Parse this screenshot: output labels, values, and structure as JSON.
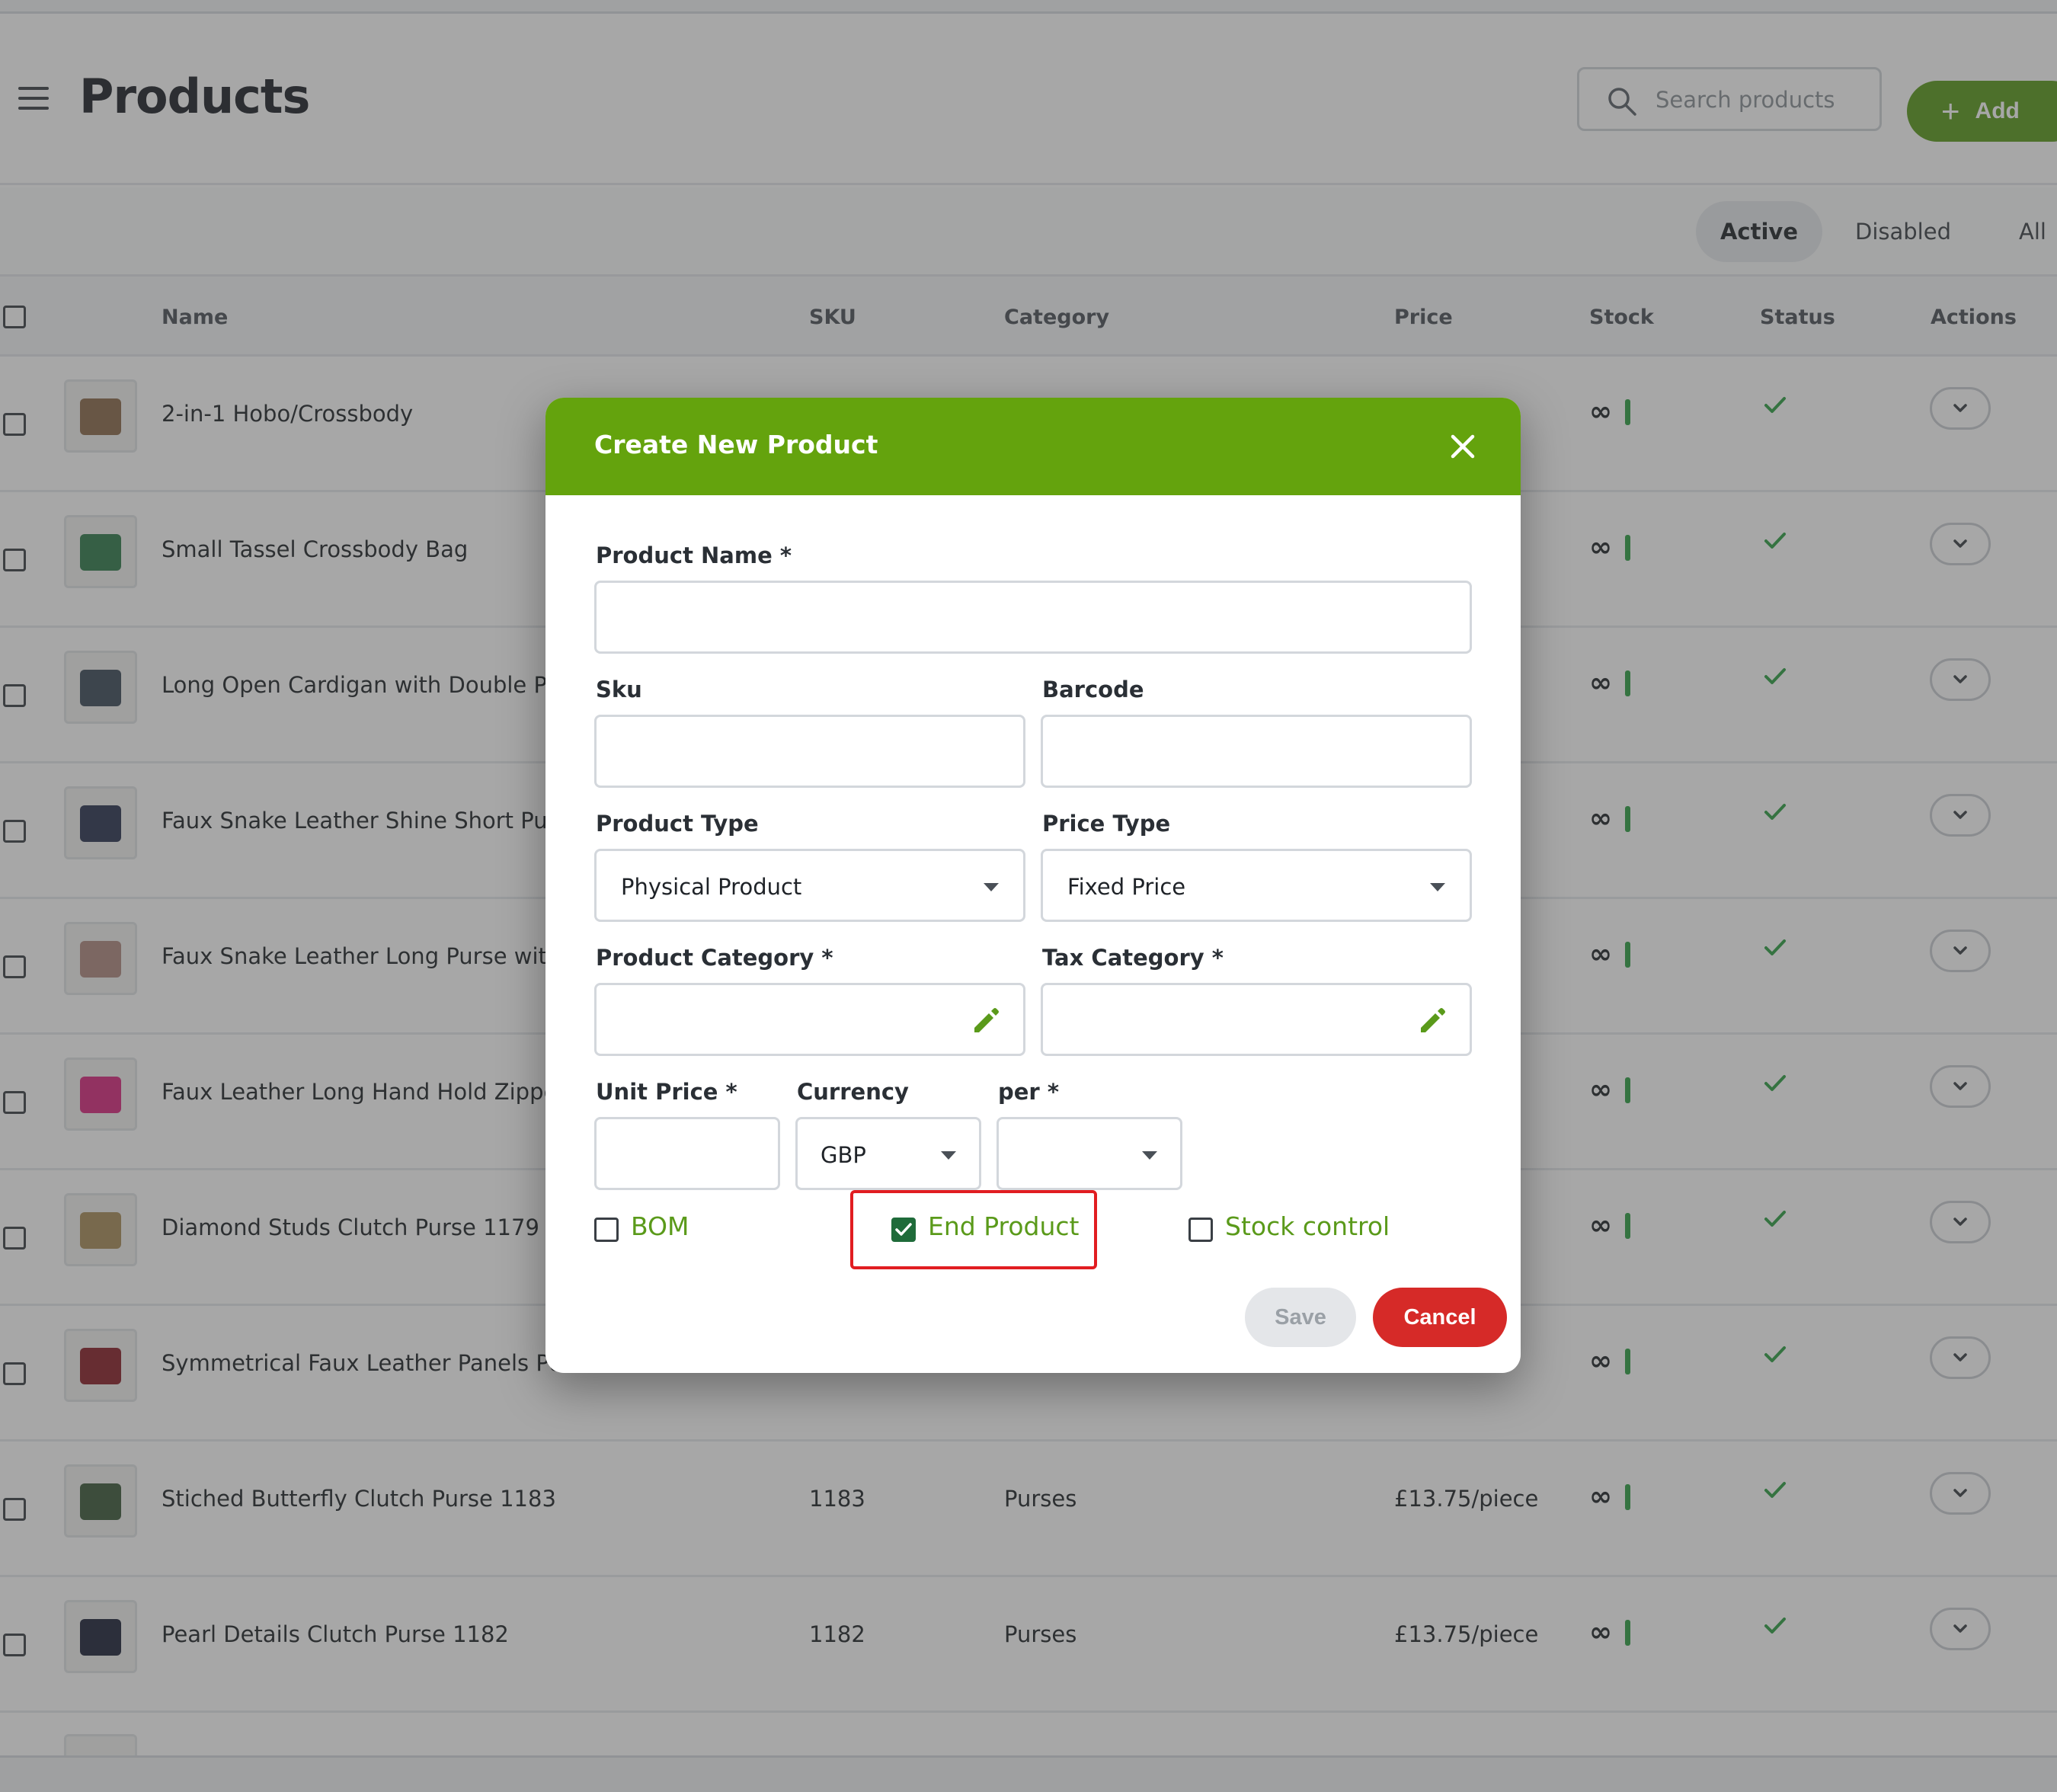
{
  "header": {
    "title": "Products",
    "search_placeholder": "Search products",
    "add_label": "Add"
  },
  "tabs": [
    {
      "label": "Active",
      "active": true
    },
    {
      "label": "Disabled",
      "active": false
    },
    {
      "label": "All",
      "active": false
    }
  ],
  "table": {
    "columns": [
      "Name",
      "SKU",
      "Category",
      "Price",
      "Stock",
      "Status",
      "Actions"
    ],
    "rows": [
      {
        "name": "2-in-1 Hobo/Crossbody",
        "sku": "",
        "category": "",
        "price": "e",
        "stock": "∞"
      },
      {
        "name": "Small Tassel Crossbody Bag",
        "sku": "",
        "category": "",
        "price": "",
        "stock": "∞"
      },
      {
        "name": "Long Open Cardigan with Double Pocl",
        "sku": "",
        "category": "",
        "price": "e",
        "stock": "∞"
      },
      {
        "name": "Faux Snake Leather Shine Short Purse",
        "sku": "",
        "category": "",
        "price": "e",
        "stock": "∞"
      },
      {
        "name": "Faux Snake Leather Long Purse with S",
        "sku": "",
        "category": "",
        "price": "e",
        "stock": "∞"
      },
      {
        "name": "Faux Leather Long Hand Hold Zipped",
        "sku": "",
        "category": "",
        "price": "",
        "stock": "∞"
      },
      {
        "name": "Diamond Studs Clutch Purse 1179",
        "sku": "",
        "category": "",
        "price": "",
        "stock": "∞"
      },
      {
        "name": "Symmetrical Faux Leather Panels Purs",
        "sku": "",
        "category": "",
        "price": "e",
        "stock": "∞"
      },
      {
        "name": "Stiched Butterfly Clutch Purse 1183",
        "sku": "1183",
        "category": "Purses",
        "price": "£13.75/piece",
        "stock": "∞"
      },
      {
        "name": "Pearl Details Clutch Purse 1182",
        "sku": "1182",
        "category": "Purses",
        "price": "£13.75/piece",
        "stock": "∞"
      }
    ]
  },
  "modal": {
    "title": "Create New Product",
    "product_name_label": "Product Name *",
    "sku_label": "Sku",
    "barcode_label": "Barcode",
    "product_type_label": "Product Type",
    "product_type_value": "Physical Product",
    "price_type_label": "Price Type",
    "price_type_value": "Fixed Price",
    "product_category_label": "Product Category *",
    "tax_category_label": "Tax Category *",
    "unit_price_label": "Unit Price *",
    "currency_label": "Currency",
    "currency_value": "GBP",
    "per_label": "per *",
    "per_value": "",
    "options": {
      "bom": {
        "label": "BOM",
        "checked": false
      },
      "end_product": {
        "label": "End Product",
        "checked": true
      },
      "stock_control": {
        "label": "Stock control",
        "checked": false
      }
    },
    "save_label": "Save",
    "cancel_label": "Cancel"
  },
  "colors": {
    "brand_green": "#64a30d",
    "option_text_green": "#5a9a1a",
    "cancel_red": "#d62a28",
    "highlight_red": "#e11d21",
    "status_green": "#2ea043"
  },
  "icons": [
    "menu-icon",
    "search-icon",
    "plus-icon",
    "close-icon",
    "pencil-icon",
    "chevron-down-icon",
    "check-icon"
  ]
}
